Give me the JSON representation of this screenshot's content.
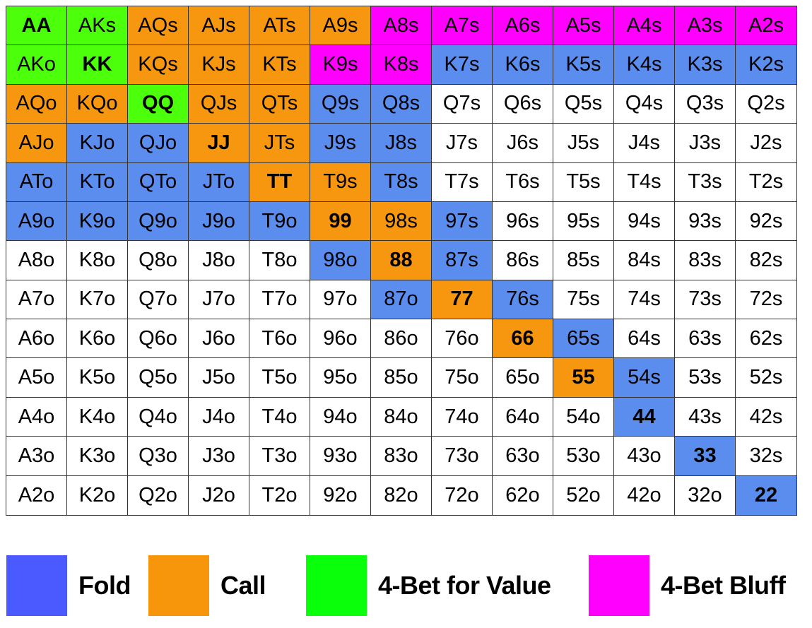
{
  "chart_data": {
    "type": "table",
    "ranks": [
      "A",
      "K",
      "Q",
      "J",
      "T",
      "9",
      "8",
      "7",
      "6",
      "5",
      "4",
      "3",
      "2"
    ],
    "hands": [
      [
        "AA",
        "AKs",
        "AQs",
        "AJs",
        "ATs",
        "A9s",
        "A8s",
        "A7s",
        "A6s",
        "A5s",
        "A4s",
        "A3s",
        "A2s"
      ],
      [
        "AKo",
        "KK",
        "KQs",
        "KJs",
        "KTs",
        "K9s",
        "K8s",
        "K7s",
        "K6s",
        "K5s",
        "K4s",
        "K3s",
        "K2s"
      ],
      [
        "AQo",
        "KQo",
        "QQ",
        "QJs",
        "QTs",
        "Q9s",
        "Q8s",
        "Q7s",
        "Q6s",
        "Q5s",
        "Q4s",
        "Q3s",
        "Q2s"
      ],
      [
        "AJo",
        "KJo",
        "QJo",
        "JJ",
        "JTs",
        "J9s",
        "J8s",
        "J7s",
        "J6s",
        "J5s",
        "J4s",
        "J3s",
        "J2s"
      ],
      [
        "ATo",
        "KTo",
        "QTo",
        "JTo",
        "TT",
        "T9s",
        "T8s",
        "T7s",
        "T6s",
        "T5s",
        "T4s",
        "T3s",
        "T2s"
      ],
      [
        "A9o",
        "K9o",
        "Q9o",
        "J9o",
        "T9o",
        "99",
        "98s",
        "97s",
        "96s",
        "95s",
        "94s",
        "93s",
        "92s"
      ],
      [
        "A8o",
        "K8o",
        "Q8o",
        "J8o",
        "T8o",
        "98o",
        "88",
        "87s",
        "86s",
        "85s",
        "84s",
        "83s",
        "82s"
      ],
      [
        "A7o",
        "K7o",
        "Q7o",
        "J7o",
        "T7o",
        "97o",
        "87o",
        "77",
        "76s",
        "75s",
        "74s",
        "73s",
        "72s"
      ],
      [
        "A6o",
        "K6o",
        "Q6o",
        "J6o",
        "T6o",
        "96o",
        "86o",
        "76o",
        "66",
        "65s",
        "64s",
        "63s",
        "62s"
      ],
      [
        "A5o",
        "K5o",
        "Q5o",
        "J5o",
        "T5o",
        "95o",
        "85o",
        "75o",
        "65o",
        "55",
        "54s",
        "53s",
        "52s"
      ],
      [
        "A4o",
        "K4o",
        "Q4o",
        "J4o",
        "T4o",
        "94o",
        "84o",
        "74o",
        "64o",
        "54o",
        "44",
        "43s",
        "42s"
      ],
      [
        "A3o",
        "K3o",
        "Q3o",
        "J3o",
        "T3o",
        "93o",
        "83o",
        "73o",
        "63o",
        "53o",
        "43o",
        "33",
        "32s"
      ],
      [
        "A2o",
        "K2o",
        "Q2o",
        "J2o",
        "T2o",
        "92o",
        "82o",
        "72o",
        "62o",
        "52o",
        "42o",
        "32o",
        "22"
      ]
    ],
    "actions": [
      [
        "V",
        "V",
        "C",
        "C",
        "C",
        "C",
        "B",
        "B",
        "B",
        "B",
        "B",
        "B",
        "B"
      ],
      [
        "V",
        "V",
        "C",
        "C",
        "C",
        "B",
        "B",
        "F",
        "F",
        "F",
        "F",
        "F",
        "F"
      ],
      [
        "C",
        "C",
        "V",
        "C",
        "C",
        "F",
        "F",
        "-",
        "-",
        "-",
        "-",
        "-",
        "-"
      ],
      [
        "C",
        "F",
        "F",
        "C",
        "C",
        "F",
        "F",
        "-",
        "-",
        "-",
        "-",
        "-",
        "-"
      ],
      [
        "F",
        "F",
        "F",
        "F",
        "C",
        "C",
        "F",
        "-",
        "-",
        "-",
        "-",
        "-",
        "-"
      ],
      [
        "F",
        "F",
        "F",
        "F",
        "F",
        "C",
        "C",
        "F",
        "-",
        "-",
        "-",
        "-",
        "-"
      ],
      [
        "-",
        "-",
        "-",
        "-",
        "-",
        "F",
        "C",
        "F",
        "-",
        "-",
        "-",
        "-",
        "-"
      ],
      [
        "-",
        "-",
        "-",
        "-",
        "-",
        "-",
        "F",
        "C",
        "F",
        "-",
        "-",
        "-",
        "-"
      ],
      [
        "-",
        "-",
        "-",
        "-",
        "-",
        "-",
        "-",
        "-",
        "C",
        "F",
        "-",
        "-",
        "-"
      ],
      [
        "-",
        "-",
        "-",
        "-",
        "-",
        "-",
        "-",
        "-",
        "-",
        "C",
        "F",
        "-",
        "-"
      ],
      [
        "-",
        "-",
        "-",
        "-",
        "-",
        "-",
        "-",
        "-",
        "-",
        "-",
        "F",
        "-",
        "-"
      ],
      [
        "-",
        "-",
        "-",
        "-",
        "-",
        "-",
        "-",
        "-",
        "-",
        "-",
        "-",
        "F",
        "-"
      ],
      [
        "-",
        "-",
        "-",
        "-",
        "-",
        "-",
        "-",
        "-",
        "-",
        "-",
        "-",
        "-",
        "F"
      ]
    ],
    "cell_colors": {
      "F": "#5b8def",
      "C": "#f7960f",
      "V": "#4cff0a",
      "B": "#ff00ff",
      "-": "#ffffff"
    },
    "legend": [
      {
        "label": "Fold",
        "color": "#4a5aff"
      },
      {
        "label": "Call",
        "color": "#f7960a"
      },
      {
        "label": "4-Bet for Value",
        "color": "#0aff0a"
      },
      {
        "label": "4-Bet Bluff",
        "color": "#ff00ff"
      }
    ],
    "legend_position": "bottom"
  }
}
